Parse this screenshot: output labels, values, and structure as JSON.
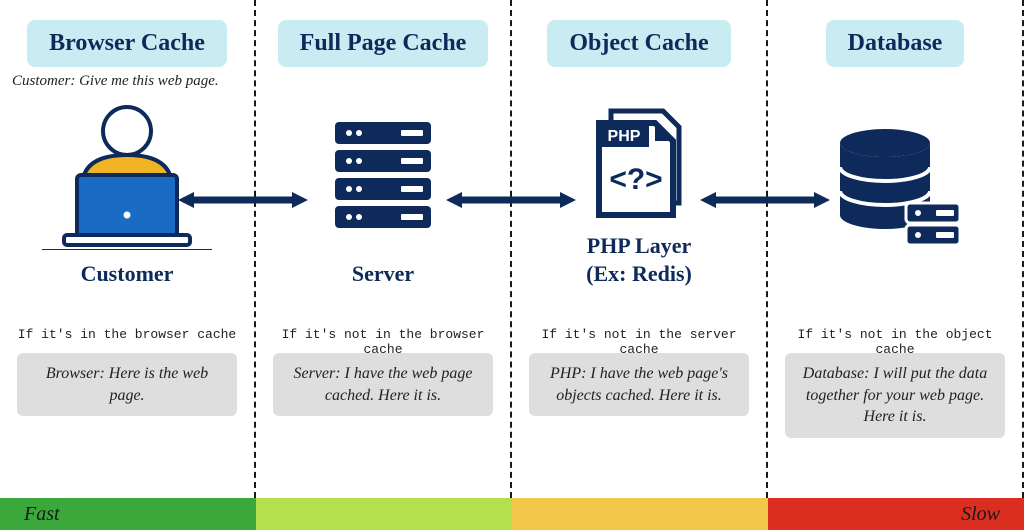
{
  "columns": [
    {
      "header": "Browser Cache",
      "request": "Customer: Give me this web page.",
      "iconLabel": "Customer",
      "condition": "If it's in the browser cache",
      "response": "Browser: Here is the web page."
    },
    {
      "header": "Full Page Cache",
      "request": "",
      "iconLabel": "Server",
      "condition": "If it's not in the browser cache",
      "response": "Server: I have the web page cached. Here it is."
    },
    {
      "header": "Object Cache",
      "request": "",
      "iconLabel": "PHP Layer\n(Ex: Redis)",
      "phpBadge": "PHP",
      "condition": "If it's not in the server cache",
      "response": "PHP: I have the web page's objects cached. Here it is."
    },
    {
      "header": "Database",
      "request": "",
      "iconLabel": "",
      "condition": "If it's not in the object cache",
      "response": "Database: I will put the data together for your web page. Here it is."
    }
  ],
  "speed": {
    "fast": "Fast",
    "slow": "Slow"
  },
  "colors": {
    "navy": "#0d2a5b",
    "headerBg": "#c8ecf2",
    "responseBg": "#dedede",
    "seg1": "#3aa83a",
    "seg2": "#b5e04d",
    "seg3": "#f2c84b",
    "seg4": "#d92e20",
    "laptopBlue": "#1a6bc4",
    "shirtYellow": "#f0b324"
  }
}
